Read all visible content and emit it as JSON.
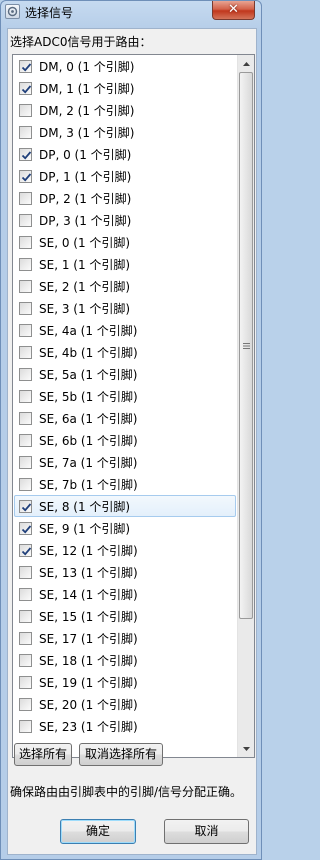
{
  "window": {
    "title": "选择信号",
    "close_label": "✕"
  },
  "prompt": "选择ADC0信号用于路由：",
  "items": [
    {
      "label": "DM, 0 (1 个引脚)",
      "checked": true
    },
    {
      "label": "DM, 1 (1 个引脚)",
      "checked": true
    },
    {
      "label": "DM, 2 (1 个引脚)",
      "checked": false
    },
    {
      "label": "DM, 3 (1 个引脚)",
      "checked": false
    },
    {
      "label": "DP, 0 (1 个引脚)",
      "checked": true
    },
    {
      "label": "DP, 1 (1 个引脚)",
      "checked": true
    },
    {
      "label": "DP, 2 (1 个引脚)",
      "checked": false
    },
    {
      "label": "DP, 3 (1 个引脚)",
      "checked": false
    },
    {
      "label": "SE, 0 (1 个引脚)",
      "checked": false
    },
    {
      "label": "SE, 1 (1 个引脚)",
      "checked": false
    },
    {
      "label": "SE, 2 (1 个引脚)",
      "checked": false
    },
    {
      "label": "SE, 3 (1 个引脚)",
      "checked": false
    },
    {
      "label": "SE, 4a (1 个引脚)",
      "checked": false
    },
    {
      "label": "SE, 4b (1 个引脚)",
      "checked": false
    },
    {
      "label": "SE, 5a (1 个引脚)",
      "checked": false
    },
    {
      "label": "SE, 5b (1 个引脚)",
      "checked": false
    },
    {
      "label": "SE, 6a (1 个引脚)",
      "checked": false
    },
    {
      "label": "SE, 6b (1 个引脚)",
      "checked": false
    },
    {
      "label": "SE, 7a (1 个引脚)",
      "checked": false
    },
    {
      "label": "SE, 7b (1 个引脚)",
      "checked": false
    },
    {
      "label": "SE, 8 (1 个引脚)",
      "checked": true,
      "selected": true
    },
    {
      "label": "SE, 9 (1 个引脚)",
      "checked": true
    },
    {
      "label": "SE, 12 (1 个引脚)",
      "checked": true
    },
    {
      "label": "SE, 13 (1 个引脚)",
      "checked": false
    },
    {
      "label": "SE, 14 (1 个引脚)",
      "checked": false
    },
    {
      "label": "SE, 15 (1 个引脚)",
      "checked": false
    },
    {
      "label": "SE, 17 (1 个引脚)",
      "checked": false
    },
    {
      "label": "SE, 18 (1 个引脚)",
      "checked": false
    },
    {
      "label": "SE, 19 (1 个引脚)",
      "checked": false
    },
    {
      "label": "SE, 20 (1 个引脚)",
      "checked": false
    },
    {
      "label": "SE, 23 (1 个引脚)",
      "checked": false
    }
  ],
  "buttons": {
    "select_all": "选择所有",
    "deselect_all": "取消选择所有",
    "ok": "确定",
    "cancel": "取消"
  },
  "note": "确保路由由引脚表中的引脚/信号分配正确。",
  "colors": {
    "title_bar": "#c6daf0",
    "client_bg": "#f0f0f0",
    "selection_border": "#a6cbee",
    "check_mark": "#1f3f7a",
    "close_button": "#c1371d"
  }
}
